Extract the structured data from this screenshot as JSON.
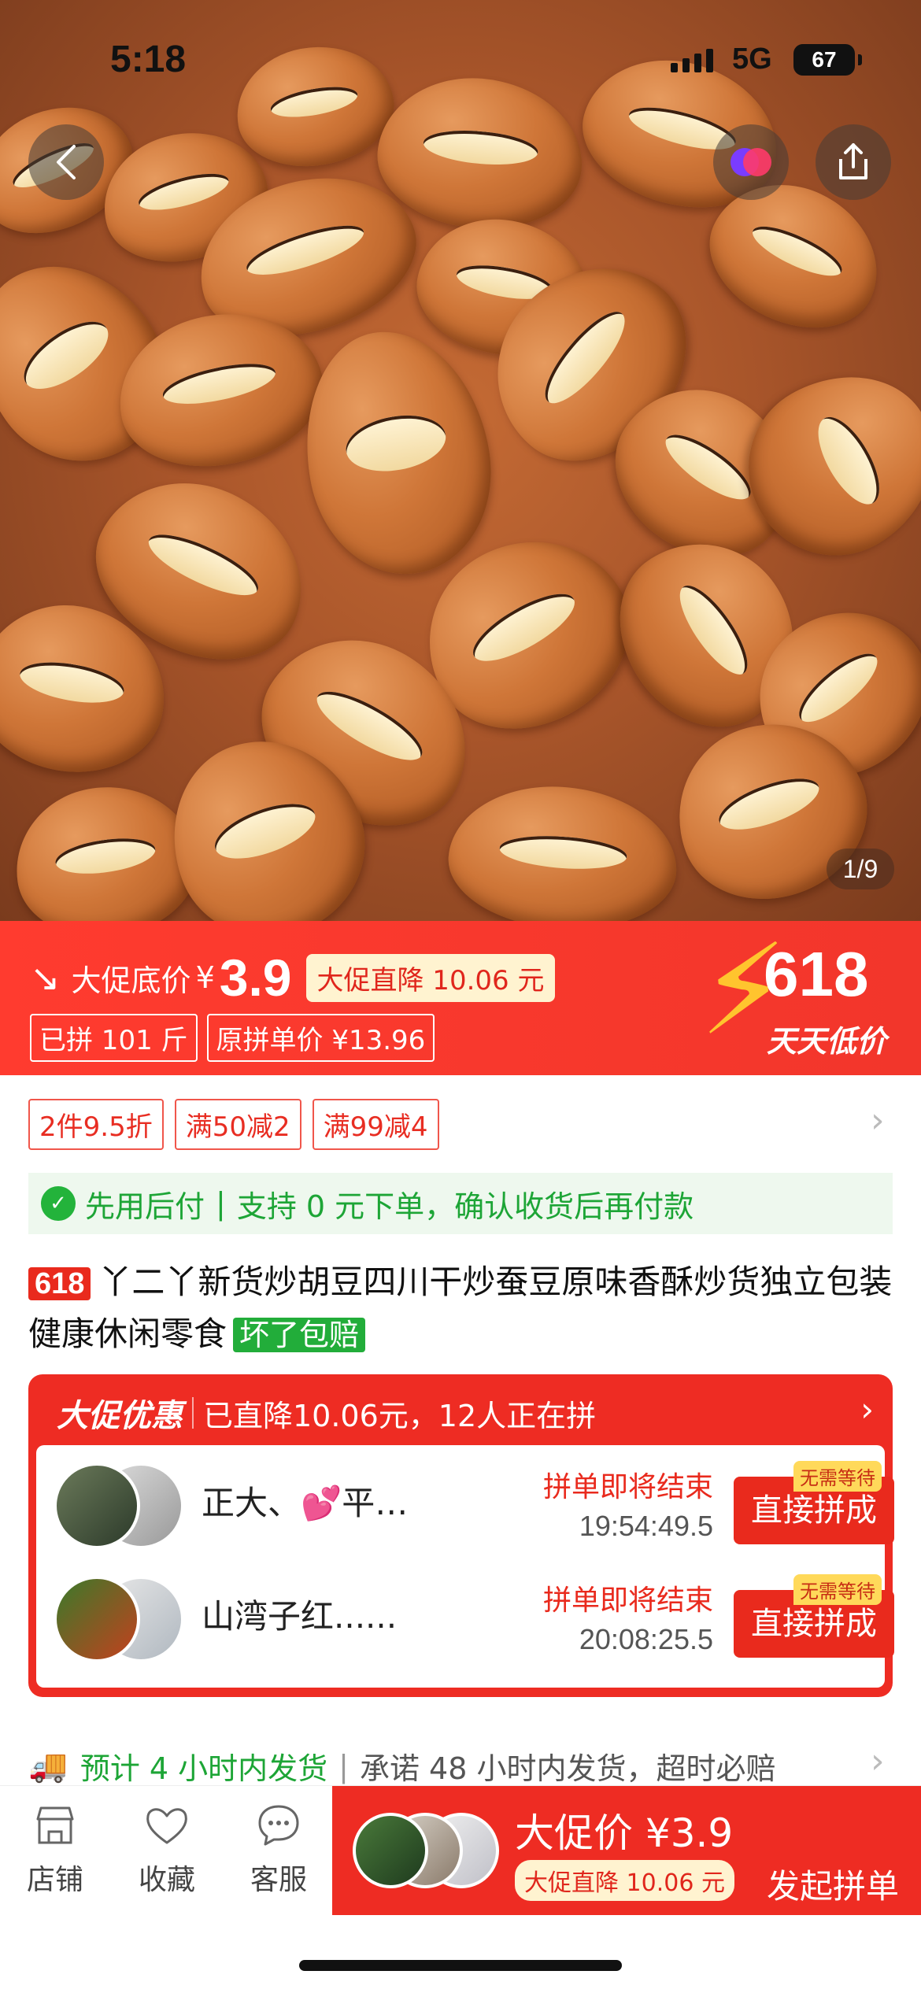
{
  "status_bar": {
    "time": "5:18",
    "network": "5G",
    "battery": "67"
  },
  "hero": {
    "pager": "1/9"
  },
  "promo": {
    "label": "大促底价",
    "currency": "¥",
    "price": "3.9",
    "drop_tag": "大促直降 10.06 元",
    "sold": "已拼 101 斤",
    "original_price": "原拼单价 ¥13.96",
    "badge_number": "618",
    "badge_slogan": "天天低价"
  },
  "coupons": [
    "2件9.5折",
    "满50减2",
    "满99减4"
  ],
  "paylater": {
    "left": "先用后付",
    "right": "支持 0 元下单，确认收货后再付款"
  },
  "title": {
    "tag": "618",
    "text": "丫二丫新货炒胡豆四川干炒蚕豆原味香酥炒货独立包装健康休闲零食",
    "guarantee": "坏了包赔"
  },
  "group_buy": {
    "header_brand": "大促优惠",
    "header_text": "已直降10.06元，12人正在拼",
    "rows": [
      {
        "name": "正大、💕平…",
        "status": "拼单即将结束",
        "time": "19:54:49.5",
        "button": "直接拼成",
        "wait_tag": "无需等待"
      },
      {
        "name": "山湾子红......",
        "status": "拼单即将结束",
        "time": "20:08:25.5",
        "button": "直接拼成",
        "wait_tag": "无需等待"
      }
    ]
  },
  "shipping": {
    "left": "预计 4 小时内发货",
    "right": "承诺 48 小时内发货，超时必赔"
  },
  "bottom_bar": {
    "tabs": [
      {
        "label": "店铺",
        "icon": "store-icon"
      },
      {
        "label": "收藏",
        "icon": "heart-icon"
      },
      {
        "label": "客服",
        "icon": "chat-icon"
      }
    ],
    "order_price": "大促价 ¥3.9",
    "order_drop": "大促直降 10.06 元",
    "order_action": "发起拼单"
  },
  "colors": {
    "accent": "#ee2c23",
    "green": "#1da536",
    "badge_yellow": "#ffc42e"
  }
}
